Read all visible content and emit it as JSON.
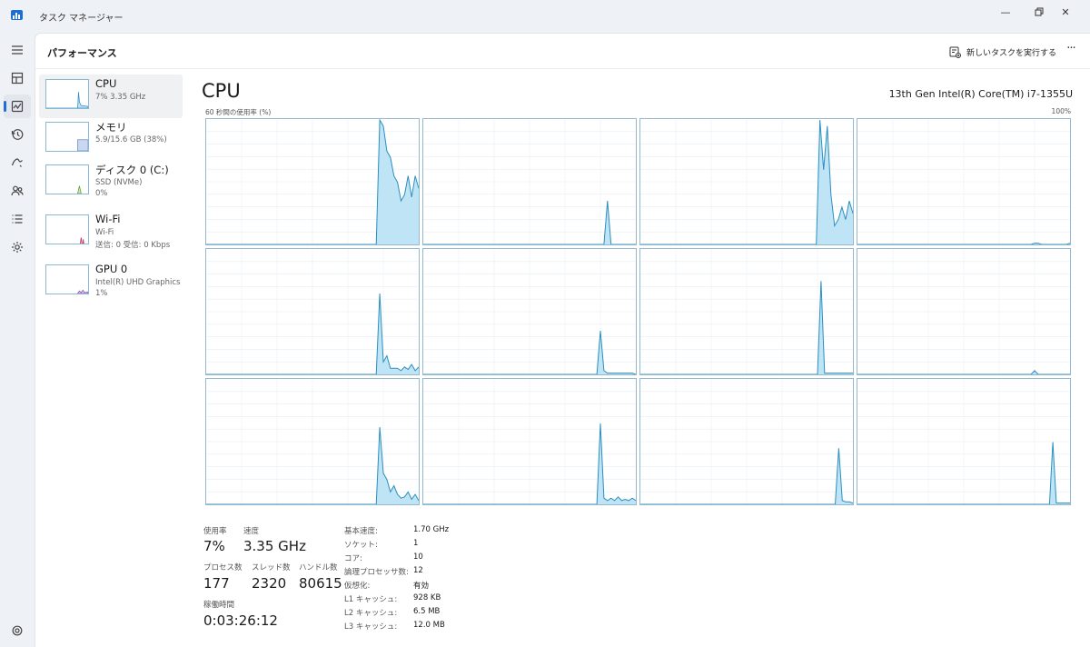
{
  "window": {
    "title": "タスク マネージャー"
  },
  "header": {
    "page_title": "パフォーマンス",
    "run_task": "新しいタスクを実行する",
    "more": "···"
  },
  "devices": [
    {
      "name": "CPU",
      "sub": [
        "7% 3.35 GHz"
      ]
    },
    {
      "name": "メモリ",
      "sub": [
        "5.9/15.6 GB (38%)"
      ]
    },
    {
      "name": "ディスク 0 (C:)",
      "sub": [
        "SSD (NVMe)",
        "0%"
      ]
    },
    {
      "name": "Wi-Fi",
      "sub": [
        "Wi-Fi",
        "送信: 0 受信: 0 Kbps"
      ]
    },
    {
      "name": "GPU 0",
      "sub": [
        "Intel(R) UHD Graphics",
        "1%"
      ]
    }
  ],
  "main": {
    "heading": "CPU",
    "model": "13th Gen Intel(R) Core(TM) i7-1355U",
    "graph_label": "60 秒間の使用率 (%)",
    "graph_max": "100%"
  },
  "stats": {
    "usage_label": "使用率",
    "usage": "7%",
    "speed_label": "速度",
    "speed": "3.35 GHz",
    "processes_label": "プロセス数",
    "processes": "177",
    "threads_label": "スレッド数",
    "threads": "2320",
    "handles_label": "ハンドル数",
    "handles": "80615",
    "uptime_label": "稼働時間",
    "uptime": "0:03:26:12"
  },
  "specs": [
    {
      "key": "基本速度:",
      "value": "1.70 GHz"
    },
    {
      "key": "ソケット:",
      "value": "1"
    },
    {
      "key": "コア:",
      "value": "10"
    },
    {
      "key": "論理プロセッサ数:",
      "value": "12"
    },
    {
      "key": "仮想化:",
      "value": "有効"
    },
    {
      "key": "L1 キャッシュ:",
      "value": "928 KB"
    },
    {
      "key": "L2 キャッシュ:",
      "value": "6.5 MB"
    },
    {
      "key": "L3 キャッシュ:",
      "value": "12.0 MB"
    }
  ],
  "colors": {
    "accent": "#1d6fd8",
    "graph_line": "#2b8fbf",
    "graph_fill": "#bfe4f6",
    "grid": "#e6eef3"
  },
  "chart_data": {
    "type": "area",
    "y_range": [
      0,
      100
    ],
    "series": [
      {
        "values": [
          0,
          0,
          0,
          0,
          0,
          0,
          0,
          0,
          0,
          0,
          0,
          0,
          0,
          0,
          0,
          0,
          0,
          0,
          0,
          0,
          0,
          0,
          0,
          0,
          0,
          0,
          0,
          0,
          0,
          0,
          0,
          0,
          0,
          0,
          0,
          0,
          0,
          0,
          0,
          0,
          0,
          0,
          0,
          0,
          0,
          0,
          0,
          0,
          0,
          100,
          95,
          75,
          70,
          55,
          50,
          35,
          40,
          55,
          38,
          55,
          45
        ]
      },
      {
        "values": [
          0,
          0,
          0,
          0,
          0,
          0,
          0,
          0,
          0,
          0,
          0,
          0,
          0,
          0,
          0,
          0,
          0,
          0,
          0,
          0,
          0,
          0,
          0,
          0,
          0,
          0,
          0,
          0,
          0,
          0,
          0,
          0,
          0,
          0,
          0,
          0,
          0,
          0,
          0,
          0,
          0,
          0,
          0,
          0,
          0,
          0,
          0,
          0,
          0,
          0,
          0,
          0,
          35,
          0,
          0,
          0,
          0,
          0,
          0,
          0,
          0
        ]
      },
      {
        "values": [
          0,
          0,
          0,
          0,
          0,
          0,
          0,
          0,
          0,
          0,
          0,
          0,
          0,
          0,
          0,
          0,
          0,
          0,
          0,
          0,
          0,
          0,
          0,
          0,
          0,
          0,
          0,
          0,
          0,
          0,
          0,
          0,
          0,
          0,
          0,
          0,
          0,
          0,
          0,
          0,
          0,
          0,
          0,
          0,
          0,
          0,
          0,
          0,
          0,
          100,
          60,
          95,
          40,
          15,
          20,
          30,
          20,
          35,
          25
        ]
      },
      {
        "values": [
          0,
          0,
          0,
          0,
          0,
          0,
          0,
          0,
          0,
          0,
          0,
          0,
          0,
          0,
          0,
          0,
          0,
          0,
          0,
          0,
          0,
          0,
          0,
          0,
          0,
          0,
          0,
          0,
          0,
          0,
          0,
          0,
          0,
          0,
          0,
          0,
          0,
          0,
          0,
          0,
          0,
          0,
          0,
          0,
          0,
          0,
          0,
          0,
          0,
          0,
          1,
          1,
          0,
          0,
          0,
          0,
          0,
          0,
          0,
          0,
          1
        ]
      },
      {
        "values": [
          0,
          0,
          0,
          0,
          0,
          0,
          0,
          0,
          0,
          0,
          0,
          0,
          0,
          0,
          0,
          0,
          0,
          0,
          0,
          0,
          0,
          0,
          0,
          0,
          0,
          0,
          0,
          0,
          0,
          0,
          0,
          0,
          0,
          0,
          0,
          0,
          0,
          0,
          0,
          0,
          0,
          0,
          0,
          0,
          0,
          0,
          0,
          0,
          0,
          65,
          10,
          15,
          5,
          5,
          5,
          3,
          6,
          4,
          8,
          3,
          6
        ]
      },
      {
        "values": [
          0,
          0,
          0,
          0,
          0,
          0,
          0,
          0,
          0,
          0,
          0,
          0,
          0,
          0,
          0,
          0,
          0,
          0,
          0,
          0,
          0,
          0,
          0,
          0,
          0,
          0,
          0,
          0,
          0,
          0,
          0,
          0,
          0,
          0,
          0,
          0,
          0,
          0,
          0,
          0,
          0,
          0,
          0,
          0,
          0,
          0,
          0,
          0,
          0,
          0,
          35,
          3,
          1,
          1,
          1,
          1,
          1,
          1,
          1,
          1,
          0
        ]
      },
      {
        "values": [
          0,
          0,
          0,
          0,
          0,
          0,
          0,
          0,
          0,
          0,
          0,
          0,
          0,
          0,
          0,
          0,
          0,
          0,
          0,
          0,
          0,
          0,
          0,
          0,
          0,
          0,
          0,
          0,
          0,
          0,
          0,
          0,
          0,
          0,
          0,
          0,
          0,
          0,
          0,
          0,
          0,
          0,
          0,
          0,
          0,
          0,
          0,
          0,
          0,
          0,
          0,
          75,
          1,
          1,
          1,
          1,
          1,
          1,
          1,
          1,
          1
        ]
      },
      {
        "values": [
          0,
          0,
          0,
          0,
          0,
          0,
          0,
          0,
          0,
          0,
          0,
          0,
          0,
          0,
          0,
          0,
          0,
          0,
          0,
          0,
          0,
          0,
          0,
          0,
          0,
          0,
          0,
          0,
          0,
          0,
          0,
          0,
          0,
          0,
          0,
          0,
          0,
          0,
          0,
          0,
          0,
          0,
          0,
          0,
          0,
          0,
          0,
          0,
          0,
          0,
          3,
          0,
          0,
          0,
          0,
          0,
          0,
          0,
          0,
          0,
          0
        ]
      },
      {
        "values": [
          0,
          0,
          0,
          0,
          0,
          0,
          0,
          0,
          0,
          0,
          0,
          0,
          0,
          0,
          0,
          0,
          0,
          0,
          0,
          0,
          0,
          0,
          0,
          0,
          0,
          0,
          0,
          0,
          0,
          0,
          0,
          0,
          0,
          0,
          0,
          0,
          0,
          0,
          0,
          0,
          0,
          0,
          0,
          0,
          0,
          0,
          0,
          0,
          0,
          62,
          25,
          20,
          10,
          15,
          8,
          5,
          6,
          10,
          4,
          8,
          3
        ]
      },
      {
        "values": [
          0,
          0,
          0,
          0,
          0,
          0,
          0,
          0,
          0,
          0,
          0,
          0,
          0,
          0,
          0,
          0,
          0,
          0,
          0,
          0,
          0,
          0,
          0,
          0,
          0,
          0,
          0,
          0,
          0,
          0,
          0,
          0,
          0,
          0,
          0,
          0,
          0,
          0,
          0,
          0,
          0,
          0,
          0,
          0,
          0,
          0,
          0,
          0,
          0,
          0,
          65,
          5,
          3,
          5,
          3,
          6,
          3,
          4,
          3,
          5,
          3
        ]
      },
      {
        "values": [
          0,
          0,
          0,
          0,
          0,
          0,
          0,
          0,
          0,
          0,
          0,
          0,
          0,
          0,
          0,
          0,
          0,
          0,
          0,
          0,
          0,
          0,
          0,
          0,
          0,
          0,
          0,
          0,
          0,
          0,
          0,
          0,
          0,
          0,
          0,
          0,
          0,
          0,
          0,
          0,
          0,
          0,
          0,
          0,
          0,
          0,
          0,
          0,
          0,
          0,
          0,
          0,
          0,
          0,
          0,
          0,
          45,
          3,
          2,
          2,
          1
        ]
      },
      {
        "values": [
          0,
          0,
          0,
          0,
          0,
          0,
          0,
          0,
          0,
          0,
          0,
          0,
          0,
          0,
          0,
          0,
          0,
          0,
          0,
          0,
          0,
          0,
          0,
          0,
          0,
          0,
          0,
          0,
          0,
          0,
          0,
          0,
          0,
          0,
          0,
          0,
          0,
          0,
          0,
          0,
          0,
          0,
          0,
          0,
          0,
          0,
          0,
          0,
          0,
          0,
          0,
          0,
          0,
          0,
          0,
          0,
          0,
          50,
          1,
          1,
          1,
          1,
          1
        ]
      }
    ]
  }
}
